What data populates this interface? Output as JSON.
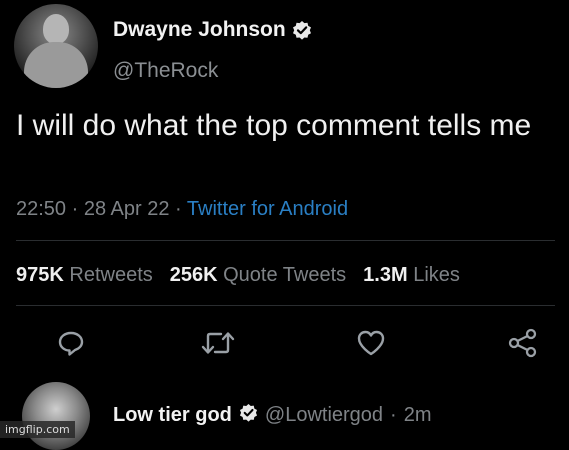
{
  "tweet": {
    "author_name": "Dwayne Johnson",
    "author_handle": "@TheRock",
    "text": "I will do what the top comment tells me",
    "time": "22:50",
    "date": "28 Apr 22",
    "source": "Twitter for Android",
    "separator": "·"
  },
  "stats": {
    "retweets_count": "975K",
    "retweets_label": "Retweets",
    "quotes_count": "256K",
    "quotes_label": "Quote Tweets",
    "likes_count": "1.3M",
    "likes_label": "Likes"
  },
  "actions": [
    {
      "name": "reply",
      "icon": "speech-bubble-icon"
    },
    {
      "name": "retweet",
      "icon": "retweet-arrows-icon"
    },
    {
      "name": "like",
      "icon": "heart-icon"
    },
    {
      "name": "share",
      "icon": "share-nodes-icon"
    }
  ],
  "reply": {
    "author_name": "Low tier god",
    "author_handle": "@Lowtiergod",
    "age": "2m"
  },
  "watermark": "imgflip.com",
  "colors": {
    "background": "#000000",
    "secondary_text": "#7f8387",
    "link": "#2a7fc4",
    "icon": "#9aa0a6"
  }
}
